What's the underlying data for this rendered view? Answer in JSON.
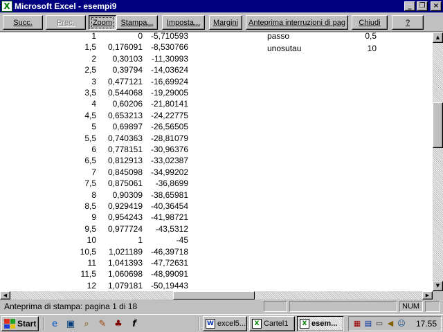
{
  "window": {
    "title": "Microsoft Excel - esempi9",
    "app_icon": "X",
    "minimize_glyph": "_",
    "maximize_glyph": "❐",
    "close_glyph": "×"
  },
  "toolbar": {
    "next": "Succ.",
    "prev": "Prec.",
    "zoom": "Zoom",
    "print": "Stampa...",
    "setup": "Imposta...",
    "margins": "Margini",
    "page_break_preview": "Anteprima interruzioni di pag",
    "close": "Chiudi",
    "help": "?"
  },
  "sheet": {
    "rows": [
      [
        "1",
        "0",
        "-5,710593"
      ],
      [
        "1,5",
        "0,176091",
        "-8,530766"
      ],
      [
        "2",
        "0,30103",
        "-11,30993"
      ],
      [
        "2,5",
        "0,39794",
        "-14,03624"
      ],
      [
        "3",
        "0,477121",
        "-16,69924"
      ],
      [
        "3,5",
        "0,544068",
        "-19,29005"
      ],
      [
        "4",
        "0,60206",
        "-21,80141"
      ],
      [
        "4,5",
        "0,653213",
        "-24,22775"
      ],
      [
        "5",
        "0,69897",
        "-26,56505"
      ],
      [
        "5,5",
        "0,740363",
        "-28,81079"
      ],
      [
        "6",
        "0,778151",
        "-30,96376"
      ],
      [
        "6,5",
        "0,812913",
        "-33,02387"
      ],
      [
        "7",
        "0,845098",
        "-34,99202"
      ],
      [
        "7,5",
        "0,875061",
        "-36,8699"
      ],
      [
        "8",
        "0,90309",
        "-38,65981"
      ],
      [
        "8,5",
        "0,929419",
        "-40,36454"
      ],
      [
        "9",
        "0,954243",
        "-41,98721"
      ],
      [
        "9,5",
        "0,977724",
        "-43,5312"
      ],
      [
        "10",
        "1",
        "-45"
      ],
      [
        "10,5",
        "1,021189",
        "-46,39718"
      ],
      [
        "11",
        "1,041393",
        "-47,72631"
      ],
      [
        "11,5",
        "1,060698",
        "-48,99091"
      ],
      [
        "12",
        "1,079181",
        "-50,19443"
      ]
    ],
    "params": [
      {
        "label": "passo",
        "value": "0,5"
      },
      {
        "label": "unosutau",
        "value": "10"
      }
    ]
  },
  "scrollbars": {
    "up": "▲",
    "down": "▼",
    "left": "◀",
    "right": "▶"
  },
  "status": {
    "text": "Anteprima di stampa: pagina 1 di 18",
    "num": "NUM"
  },
  "taskbar": {
    "start": "Start",
    "tasks": [
      {
        "label": "excel5...",
        "icon": "W"
      },
      {
        "label": "Cartel1",
        "icon": "X"
      },
      {
        "label": "esem...",
        "icon": "X"
      }
    ],
    "clock": "17.55",
    "quicklaunch_icons": [
      "ie-icon",
      "desktop-icon",
      "explorer-icon",
      "channels-icon",
      "media-icon",
      "font-icon"
    ],
    "quicklaunch_glyphs": [
      "e",
      "▣",
      "⌕",
      "✎",
      "♣",
      "f"
    ]
  }
}
